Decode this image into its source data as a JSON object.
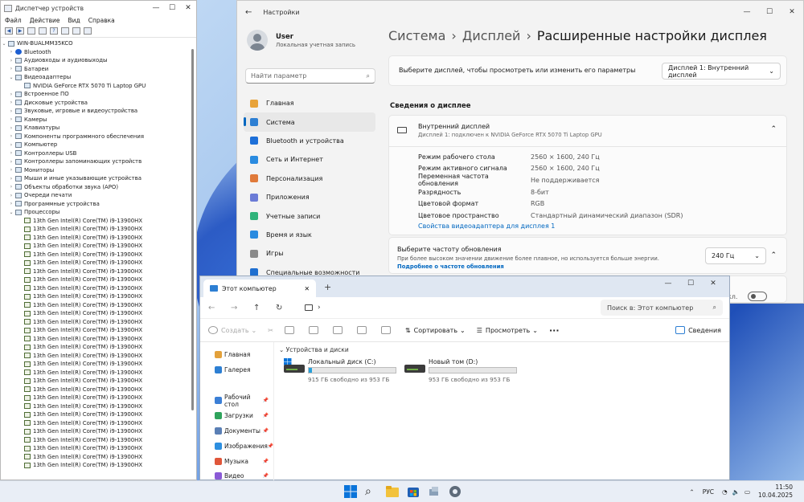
{
  "device_manager": {
    "title": "Диспетчер устройств",
    "menu": [
      "Файл",
      "Действие",
      "Вид",
      "Справка"
    ],
    "root": "WIN-BUALMM35KCO",
    "categories": [
      {
        "label": "Bluetooth",
        "expanded": false
      },
      {
        "label": "Аудиовходы и аудиовыходы",
        "expanded": false
      },
      {
        "label": "Батареи",
        "expanded": false
      },
      {
        "label": "Видеоадаптеры",
        "expanded": true,
        "children": [
          "NVIDIA GeForce RTX 5070 Ti Laptop GPU"
        ]
      },
      {
        "label": "Встроенное ПО",
        "expanded": false
      },
      {
        "label": "Дисковые устройства",
        "expanded": false
      },
      {
        "label": "Звуковые, игровые и видеоустройства",
        "expanded": false
      },
      {
        "label": "Камеры",
        "expanded": false
      },
      {
        "label": "Клавиатуры",
        "expanded": false
      },
      {
        "label": "Компоненты программного обеспечения",
        "expanded": false
      },
      {
        "label": "Компьютер",
        "expanded": false
      },
      {
        "label": "Контроллеры USB",
        "expanded": false
      },
      {
        "label": "Контроллеры запоминающих устройств",
        "expanded": false
      },
      {
        "label": "Мониторы",
        "expanded": false
      },
      {
        "label": "Мыши и иные указывающие устройства",
        "expanded": false
      },
      {
        "label": "Объекты обработки звука (APO)",
        "expanded": false
      },
      {
        "label": "Очереди печати",
        "expanded": false
      },
      {
        "label": "Программные устройства",
        "expanded": false
      },
      {
        "label": "Процессоры",
        "expanded": true
      }
    ],
    "processor_label": "13th Gen Intel(R) Core(TM) i9-13900HX",
    "processor_count": 30
  },
  "settings": {
    "title": "Настройки",
    "user_name": "User",
    "user_sub": "Локальная учетная запись",
    "search_placeholder": "Найти параметр",
    "nav": [
      {
        "label": "Главная",
        "color": "#e8a33a"
      },
      {
        "label": "Система",
        "color": "#2d7fd3",
        "active": true
      },
      {
        "label": "Bluetooth и устройства",
        "color": "#1d6fd8"
      },
      {
        "label": "Сеть и Интернет",
        "color": "#2a8be0"
      },
      {
        "label": "Персонализация",
        "color": "#e07a3a"
      },
      {
        "label": "Приложения",
        "color": "#6b7bd6"
      },
      {
        "label": "Учетные записи",
        "color": "#2fb37a"
      },
      {
        "label": "Время и язык",
        "color": "#2a8be0"
      },
      {
        "label": "Игры",
        "color": "#8a8a8a"
      },
      {
        "label": "Специальные возможности",
        "color": "#1f6fd0"
      }
    ],
    "breadcrumb": [
      "Система",
      "Дисплей",
      "Расширенные настройки дисплея"
    ],
    "choose_display_label": "Выберите дисплей, чтобы просмотреть или изменить его параметры",
    "display_select": "Дисплей 1: Внутренний дисплей",
    "section_title": "Сведения о дисплее",
    "display_name": "Внутренний дисплей",
    "display_sub": "Дисплей 1: подключен к NVIDIA GeForce RTX 5070 Ti Laptop GPU",
    "info": [
      {
        "k": "Режим рабочего стола",
        "v": "2560 × 1600, 240 Гц"
      },
      {
        "k": "Режим активного сигнала",
        "v": "2560 × 1600, 240 Гц"
      },
      {
        "k": "Переменная частота обновления",
        "v": "Не поддерживается"
      },
      {
        "k": "Разрядность",
        "v": "8-бит"
      },
      {
        "k": "Цветовой формат",
        "v": "RGB"
      },
      {
        "k": "Цветовое пространство",
        "v": "Стандартный динамический диапазон (SDR)"
      }
    ],
    "adapter_link": "Свойства видеоадаптера для дисплея 1",
    "refresh_title": "Выберите частоту обновления",
    "refresh_desc": "При более высоком значении движение более плавное, но используется больше энергии.",
    "refresh_link": "Подробнее о частоте обновления",
    "refresh_value": "240 Гц",
    "toggle_text": "Откл."
  },
  "explorer": {
    "tab_title": "Этот компьютер",
    "search_placeholder": "Поиск в: Этот компьютер",
    "commands": {
      "create": "Создать",
      "sort": "Сортировать",
      "view": "Просмотреть",
      "details": "Сведения"
    },
    "sidebar": [
      {
        "label": "Главная",
        "color": "#e3a13b"
      },
      {
        "label": "Галерея",
        "color": "#2d7fd3"
      },
      {
        "label": "Рабочий стол",
        "color": "#3b7fd6",
        "pinned": true
      },
      {
        "label": "Загрузки",
        "color": "#2fa35c",
        "pinned": true
      },
      {
        "label": "Документы",
        "color": "#5a7fb5",
        "pinned": true
      },
      {
        "label": "Изображения",
        "color": "#2d8fe0",
        "pinned": true
      },
      {
        "label": "Музыка",
        "color": "#e0563a",
        "pinned": true
      },
      {
        "label": "Видео",
        "color": "#8a5ad6",
        "pinned": true
      }
    ],
    "group_title": "Устройства и диски",
    "drives": [
      {
        "name": "Локальный диск (C:)",
        "free": "915 ГБ свободно из 953 ГБ",
        "used_fraction": 0.04,
        "windows": true
      },
      {
        "name": "Новый том (D:)",
        "free": "953 ГБ свободно из 953 ГБ",
        "used_fraction": 0.0,
        "windows": false
      }
    ]
  },
  "taskbar": {
    "language": "РУС",
    "time": "11:50",
    "date": "10.04.2025"
  }
}
